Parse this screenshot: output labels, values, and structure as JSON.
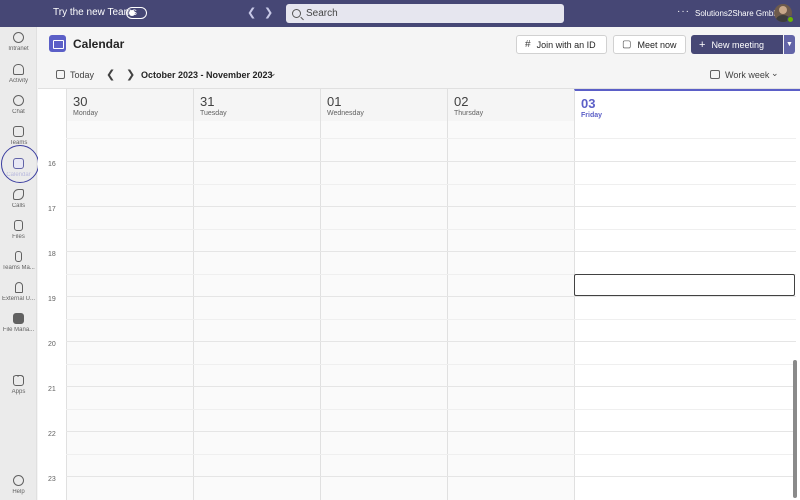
{
  "topbar": {
    "try_new": "Try the new Teams",
    "search_placeholder": "Search",
    "more": "···",
    "org": "Solutions2Share GmbH"
  },
  "rail": {
    "items": [
      {
        "label": "Intranet",
        "icon": "intranet-icon"
      },
      {
        "label": "Activity",
        "icon": "bell-icon"
      },
      {
        "label": "Chat",
        "icon": "chat-icon"
      },
      {
        "label": "Teams",
        "icon": "teams-icon"
      },
      {
        "label": "Calendar",
        "icon": "calendar-icon",
        "active": true
      },
      {
        "label": "Calls",
        "icon": "phone-icon"
      },
      {
        "label": "Files",
        "icon": "file-icon"
      },
      {
        "label": "Teams Ma...",
        "icon": "teams-manager-icon"
      },
      {
        "label": "External U...",
        "icon": "external-user-icon"
      },
      {
        "label": "File Mana...",
        "icon": "file-manager-icon"
      },
      {
        "label": "Apps",
        "icon": "apps-icon"
      },
      {
        "label": "Help",
        "icon": "help-icon"
      }
    ],
    "more": "···"
  },
  "header": {
    "title": "Calendar",
    "join_id": "Join with an ID",
    "meet_now": "Meet now",
    "new_meeting": "New meeting"
  },
  "toolbar": {
    "today": "Today",
    "range": "October 2023 - November 2023",
    "view": "Work week"
  },
  "days": [
    {
      "num": "30",
      "name": "Monday"
    },
    {
      "num": "31",
      "name": "Tuesday"
    },
    {
      "num": "01",
      "name": "Wednesday"
    },
    {
      "num": "02",
      "name": "Thursday"
    },
    {
      "num": "03",
      "name": "Friday",
      "today": true
    }
  ],
  "hours": [
    "16",
    "17",
    "18",
    "19",
    "20",
    "21",
    "22",
    "23"
  ],
  "colors": {
    "accent": "#5b5fc7",
    "topbar": "#464775"
  }
}
